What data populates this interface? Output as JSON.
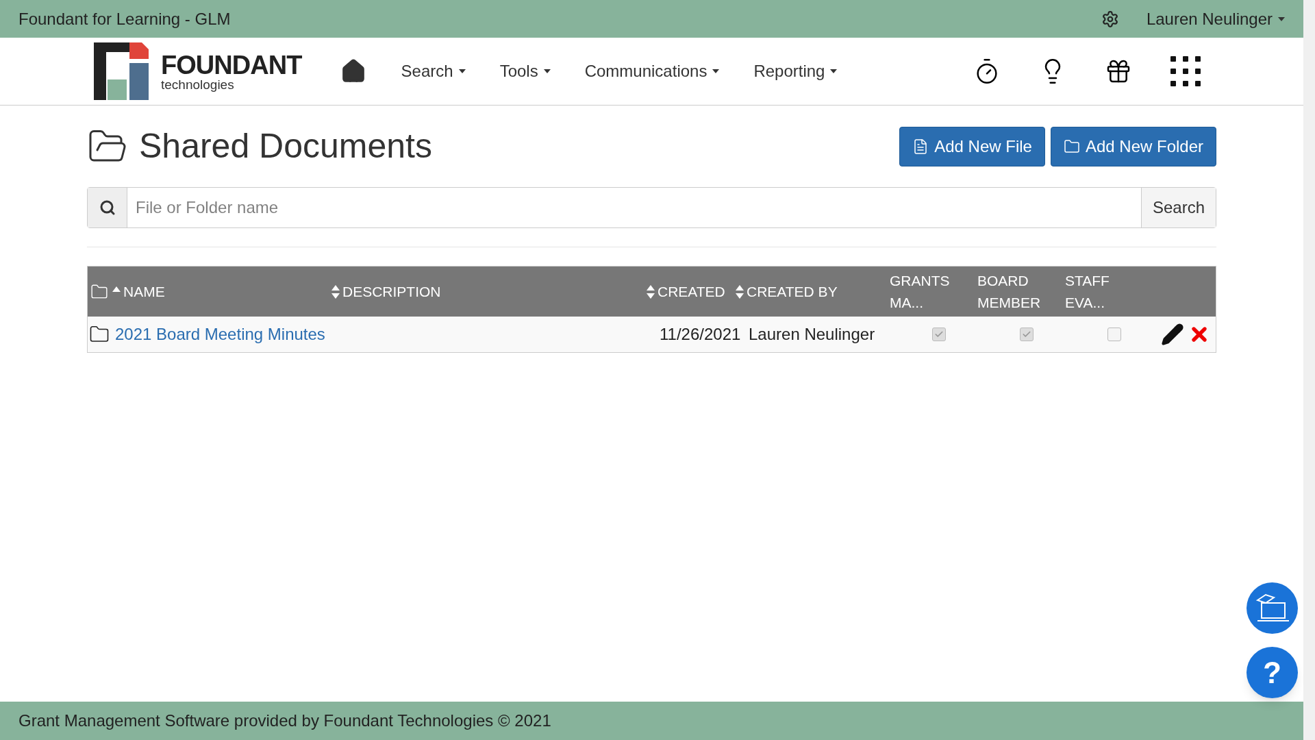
{
  "top_bar": {
    "title": "Foundant for Learning - GLM",
    "user": "Lauren Neulinger"
  },
  "logo": {
    "name": "FOUNDANT",
    "tagline": "technologies"
  },
  "nav": [
    {
      "label": "Search"
    },
    {
      "label": "Tools"
    },
    {
      "label": "Communications"
    },
    {
      "label": "Reporting"
    }
  ],
  "page": {
    "title": "Shared Documents",
    "buttons": [
      "Add New File",
      "Add New Folder"
    ]
  },
  "search": {
    "placeholder": "File or Folder name",
    "button": "Search"
  },
  "table": {
    "columns": [
      {
        "label": "NAME",
        "kind": "sorted"
      },
      {
        "label": "DESCRIPTION",
        "kind": "sortable"
      },
      {
        "label": "CREATED",
        "kind": "sortable"
      },
      {
        "label": "CREATED BY",
        "kind": "sortable"
      },
      {
        "label": "GRANTS MA...",
        "kind": "plain"
      },
      {
        "label": "BOARD MEMBER",
        "kind": "plain"
      },
      {
        "label": "STAFF EVA...",
        "kind": "plain"
      }
    ],
    "rows": [
      {
        "name": "2021 Board Meeting Minutes",
        "created": "11/26/2021",
        "created_by": "Lauren Neulinger",
        "access": [
          {
            "checked": true
          },
          {
            "checked": true
          },
          {
            "checked": false
          }
        ]
      }
    ]
  },
  "help": {
    "label": "?"
  },
  "footer": "Grant Management Software provided by Foundant Technologies © 2021"
}
